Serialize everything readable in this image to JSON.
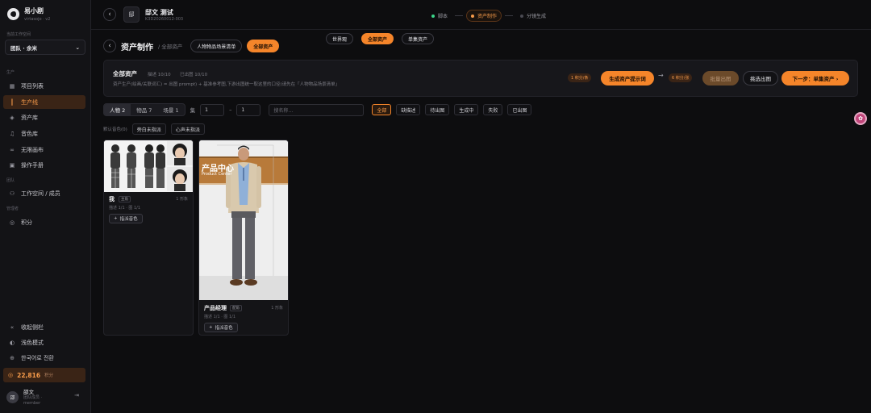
{
  "app": {
    "name": "易小剧",
    "version": "virtasojo · v2"
  },
  "workspace": {
    "label": "当前工作空间",
    "value": "团队 · 余米"
  },
  "sidebar": {
    "section_create": "生产",
    "items": [
      {
        "label": "项目列表",
        "icon": "grid-icon"
      },
      {
        "label": "生产线",
        "icon": "production-icon"
      },
      {
        "label": "资产库",
        "icon": "layers-icon"
      },
      {
        "label": "音色库",
        "icon": "waveform-icon"
      },
      {
        "label": "无限画布",
        "icon": "link-icon"
      },
      {
        "label": "操作手册",
        "icon": "book-icon"
      }
    ],
    "section_team": "团队",
    "team_items": [
      {
        "label": "工作空间 / 成员",
        "icon": "users-icon"
      }
    ],
    "section_manage": "管理者",
    "manage_items": [
      {
        "label": "积分",
        "icon": "coin-icon"
      }
    ],
    "bottom": [
      {
        "label": "收起侧栏",
        "icon": "collapse-icon"
      },
      {
        "label": "浅色模式",
        "icon": "theme-icon"
      },
      {
        "label": "한국어로 전환",
        "icon": "globe-icon"
      }
    ],
    "credits": {
      "value": "22,816",
      "unit": "积分"
    },
    "user": {
      "avatar": "邵",
      "name": "邵文",
      "role": "团队成员 ·",
      "sub": "member"
    }
  },
  "topbar": {
    "project_icon": "邸",
    "project_title": "邸文 测试",
    "project_id": "K3D20260012-003",
    "steps": [
      {
        "label": "脚本",
        "state": "done"
      },
      {
        "label": "资产制作",
        "state": "active"
      },
      {
        "label": "分镜生成",
        "state": "todo"
      }
    ],
    "sub_steps": [
      "世界观",
      "全部资产",
      "单集资产"
    ]
  },
  "page": {
    "title": "资产制作",
    "crumb": "/ 全部资产",
    "tabs": [
      "人物物品场景清单",
      "全部资产"
    ]
  },
  "panel": {
    "title": "全部资产",
    "stat_desc": "描述 10/10",
    "stat_out": "已出图 10/10",
    "desc": "资产生产(绘画/关联词汇) = 出图 prompt) + 基准参考图,下游出图统一取这里的口径(请先在「人物物品场景清单」",
    "cost1": "1 积分/条",
    "btn_generate": "生成资产提示词",
    "arrow": "→",
    "cost2": "6 积分/张",
    "btn_batch": "批量出图",
    "btn_pick": "挑选出图",
    "btn_next": "下一步：单集资产 ›"
  },
  "filters": {
    "types": [
      {
        "label": "人物 2",
        "on": true
      },
      {
        "label": "物品 7",
        "on": false
      },
      {
        "label": "场景 1",
        "on": false
      }
    ],
    "episode_label": "集",
    "ep_from": "1",
    "dash": "–",
    "ep_to": "1",
    "search_placeholder": "搜名称…",
    "status": [
      {
        "label": "全部",
        "on": true
      },
      {
        "label": "缺描述",
        "on": false
      },
      {
        "label": "待出图",
        "on": false
      },
      {
        "label": "生成中",
        "on": false
      },
      {
        "label": "失败",
        "on": false
      },
      {
        "label": "已出图",
        "on": false
      }
    ],
    "voice_label": "默认音色(0)",
    "voice_chips": [
      "旁白未指派",
      "心声未指派"
    ]
  },
  "cards": [
    {
      "name": "我",
      "tag": "主角",
      "count": "1 形象",
      "meta": "描述 1/1 · 图 1/1",
      "btn": "指派音色"
    },
    {
      "name": "产品经理",
      "tag": "配角",
      "count": "1 形象",
      "meta": "描述 1/1 · 图 1/1",
      "btn": "指派音色",
      "sign": "产品中心",
      "sign_sub": "Product Center"
    }
  ],
  "colors": {
    "accent": "#f5852a",
    "bg": "#0d0d0f",
    "success": "#3bd58a"
  }
}
